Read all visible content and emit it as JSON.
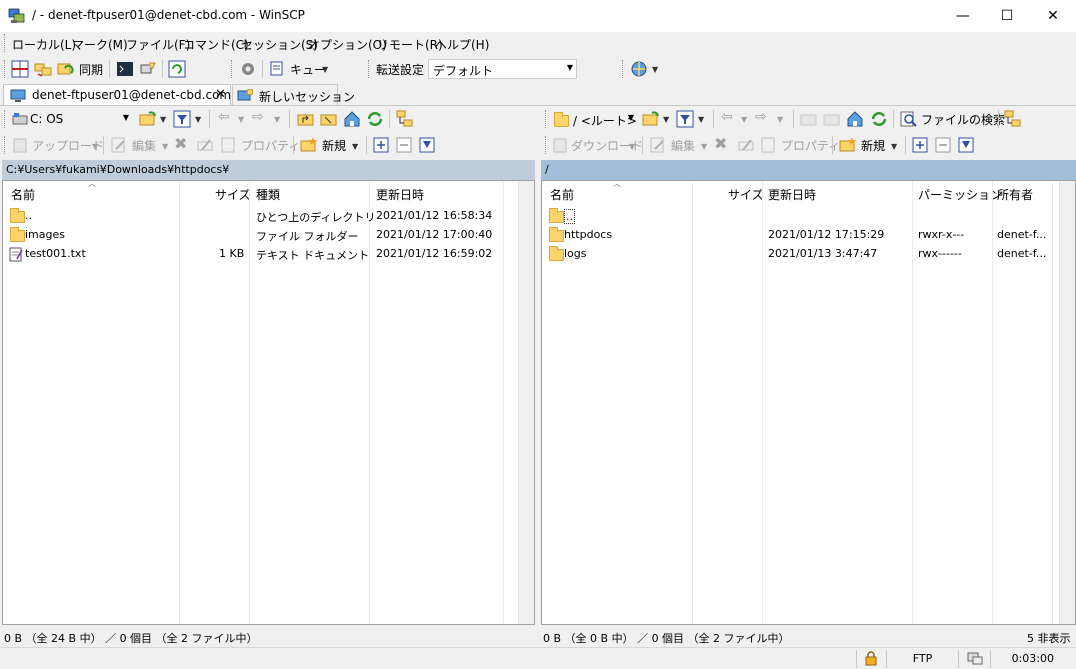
{
  "window": {
    "title": "/ - denet-ftpuser01@denet-cbd.com - WinSCP",
    "minimize": "—",
    "maximize": "☐",
    "close": "✕"
  },
  "menu": [
    "ローカル(L)",
    "マーク(M)",
    "ファイル(F)",
    "コマンド(C)",
    "セッション(S)",
    "オプション(O)",
    "リモート(R)",
    "ヘルプ(H)"
  ],
  "toolbar": {
    "sync_label": "同期",
    "queue_label": "キュー",
    "transfer_settings_label": "転送設定",
    "transfer_preset": "デフォルト"
  },
  "tabs": {
    "session": "denet-ftpuser01@denet-cbd.com",
    "new_session": "新しいセッション"
  },
  "local": {
    "drive": "C: OS",
    "upload": "アップロード",
    "edit": "編集",
    "properties": "プロパティ",
    "new": "新規",
    "path": "C:¥Users¥fukami¥Downloads¥httpdocs¥",
    "columns": [
      "名前",
      "サイズ",
      "種類",
      "更新日時"
    ],
    "files": [
      {
        "name": "..",
        "size": "",
        "type": "ひとつ上のディレクトリ",
        "modified": "2021/01/12  16:58:34",
        "icon": "parent-dir-icon"
      },
      {
        "name": "images",
        "size": "",
        "type": "ファイル フォルダー",
        "modified": "2021/01/12  17:00:40",
        "icon": "folder-icon"
      },
      {
        "name": "test001.txt",
        "size": "1 KB",
        "type": "テキスト ドキュメント",
        "modified": "2021/01/12  16:59:02",
        "icon": "text-file-icon"
      }
    ],
    "status": "0 B （全 24 B 中） ／ 0 個目 （全 2 ファイル中）"
  },
  "remote": {
    "location": "/ <ルート>",
    "download": "ダウンロード",
    "edit": "編集",
    "properties": "プロパティ",
    "new": "新規",
    "find_files": "ファイルの検索",
    "path": "/",
    "columns": [
      "名前",
      "サイズ",
      "更新日時",
      "パーミッション",
      "所有者"
    ],
    "files": [
      {
        "name": "..",
        "size": "",
        "modified": "",
        "permissions": "",
        "owner": "",
        "icon": "parent-dir-icon"
      },
      {
        "name": "httpdocs",
        "size": "",
        "modified": "2021/01/12 17:15:29",
        "permissions": "rwxr-x---",
        "owner": "denet-f...",
        "icon": "folder-icon"
      },
      {
        "name": "logs",
        "size": "",
        "modified": "2021/01/13 3:47:47",
        "permissions": "rwx------",
        "owner": "denet-f...",
        "icon": "folder-icon"
      }
    ],
    "status": "0 B （全 0 B 中） ／ 0 個目 （全 2 ファイル中）",
    "hidden": "5 非表示"
  },
  "statusbar": {
    "protocol": "FTP",
    "elapsed": "0:03:00"
  },
  "colors": {
    "pathbar_active": "#a3bed8",
    "pathbar_inactive": "#bfcddb",
    "folder": "#fcd46a"
  }
}
